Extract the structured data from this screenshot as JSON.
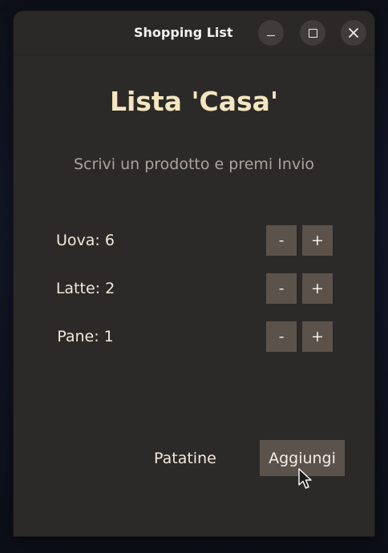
{
  "window": {
    "title": "Shopping List"
  },
  "main": {
    "heading": "Lista 'Casa'",
    "hint": "Scrivi un prodotto e premi Invio"
  },
  "items": [
    {
      "label": "Uova: 6",
      "minus": "-",
      "plus": "+"
    },
    {
      "label": "Latte: 2",
      "minus": "-",
      "plus": "+"
    },
    {
      "label": "Pane: 1",
      "minus": "-",
      "plus": "+"
    }
  ],
  "entry": {
    "value": "Patatine",
    "add_label": "Aggiungi"
  },
  "icons": {
    "minimize": "minimize-icon",
    "maximize": "maximize-icon",
    "close": "close-icon",
    "cursor": "mouse-pointer-icon"
  },
  "colors": {
    "window_bg": "#2c2a28",
    "heading": "#f4e6c0",
    "hint": "#a9a49d",
    "button_bg": "#5b524c"
  }
}
